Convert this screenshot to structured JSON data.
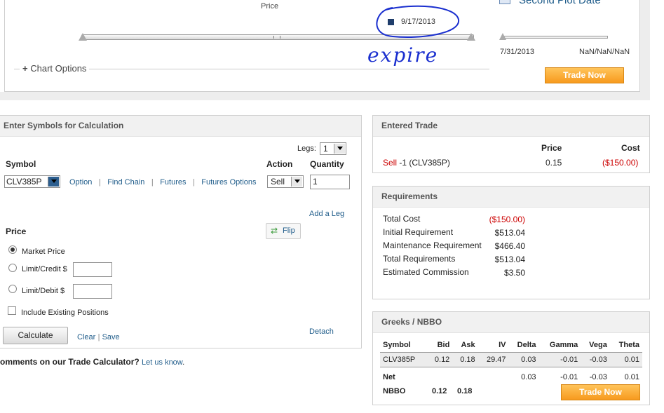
{
  "chart": {
    "price_label": "Price",
    "date_marker": "9/17/2013",
    "annotation": "expire",
    "plot_date_title": "Second Plot Date",
    "plot_date_start": "7/31/2013",
    "plot_date_end": "NaN/NaN/NaN",
    "chart_options": "Chart Options",
    "trade_now": "Trade Now"
  },
  "calc": {
    "title": "Enter Symbols for Calculation",
    "legs_label": "Legs:",
    "legs_value": "1",
    "symbol_header": "Symbol",
    "action_header": "Action",
    "quantity_header": "Quantity",
    "symbol_value": "CLV385P",
    "links": {
      "option": "Option",
      "find_chain": "Find Chain",
      "futures": "Futures",
      "futures_options": "Futures Options"
    },
    "action_value": "Sell",
    "quantity_value": "1",
    "add_leg": "Add a Leg",
    "price_header": "Price",
    "flip": "Flip",
    "market_price": "Market Price",
    "limit_credit": "Limit/Credit $",
    "limit_debit": "Limit/Debit $",
    "include_existing": "Include Existing Positions",
    "calculate": "Calculate",
    "clear": "Clear",
    "save": "Save",
    "detach": "Detach",
    "comments": "omments on our Trade Calculator?",
    "let_us_know": "Let us know"
  },
  "entered_trade": {
    "title": "Entered Trade",
    "price_header": "Price",
    "cost_header": "Cost",
    "action": "Sell",
    "desc": "-1 (CLV385P)",
    "price": "0.15",
    "cost": "($150.00)"
  },
  "requirements": {
    "title": "Requirements",
    "rows": [
      {
        "label": "Total Cost",
        "value": "($150.00)"
      },
      {
        "label": "Initial Requirement",
        "value": "$513.04"
      },
      {
        "label": "Maintenance Requirement",
        "value": "$466.40"
      },
      {
        "label": "Total Requirements",
        "value": "$513.04"
      },
      {
        "label": "Estimated Commission",
        "value": "$3.50"
      }
    ]
  },
  "greeks": {
    "title": "Greeks / NBBO",
    "headers": [
      "Symbol",
      "Bid",
      "Ask",
      "IV",
      "Delta",
      "Gamma",
      "Vega",
      "Theta"
    ],
    "row": [
      "CLV385P",
      "0.12",
      "0.18",
      "29.47",
      "0.03",
      "-0.01",
      "-0.03",
      "0.01"
    ],
    "net": [
      "Net",
      "",
      "",
      "",
      "0.03",
      "-0.01",
      "-0.03",
      "0.01"
    ],
    "nbbo_label": "NBBO",
    "nbbo_bid": "0.12",
    "nbbo_ask": "0.18",
    "trade_now": "Trade Now"
  },
  "colors": {
    "accent": "#f79a1e",
    "link": "#1f5c8a",
    "negative": "#cc0000"
  }
}
